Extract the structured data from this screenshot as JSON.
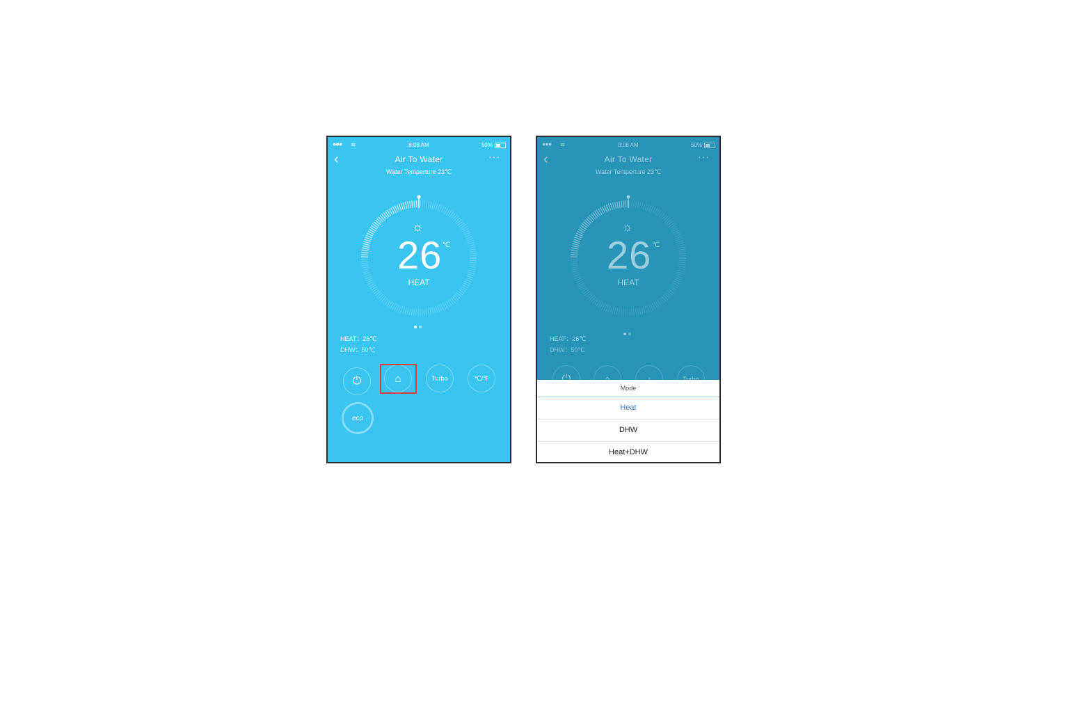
{
  "screens": [
    {
      "status": {
        "signal": "●●●",
        "wifi_icon": "wifi-icon",
        "time": "8:08 AM",
        "battery": "50%",
        "battery_level": 0.5
      },
      "header": {
        "back_glyph": "‹",
        "title": "Air To Water",
        "subtitle": "Water Temperture 23℃",
        "more_glyph": "···"
      },
      "dial": {
        "temperature": "26",
        "unit": "℃",
        "mode": "HEAT",
        "icon": "sun-icon"
      },
      "info": {
        "heat": "HEAT：26℃",
        "dhw": "DHW：50℃"
      },
      "controls": {
        "power_glyph": "⏻",
        "mode_glyph": "⌂",
        "turbo": "Turbo",
        "unit_toggle": "℃/℉",
        "eco": "eco"
      }
    },
    {
      "status": {
        "signal": "●●●",
        "wifi_icon": "wifi-icon",
        "time": "8:08 AM",
        "battery": "50%",
        "battery_level": 0.5
      },
      "header": {
        "back_glyph": "‹",
        "title": "Air To Water",
        "subtitle": "Water Temperture 23℃",
        "more_glyph": "···"
      },
      "dial": {
        "temperature": "26",
        "unit": "℃",
        "mode": "HEAT",
        "icon": "sun-icon"
      },
      "info": {
        "heat": "HEAT：26℃",
        "dhw": "DHW：50℃"
      },
      "controls": {
        "power_glyph": "⏻",
        "mode_glyph": "⌂",
        "turbo": "Turbo"
      },
      "mode_sheet": {
        "title": "Mode",
        "options": [
          "Heat",
          "DHW",
          "Heat+DHW"
        ],
        "selected": "Heat"
      }
    }
  ],
  "colors": {
    "screen_bg": "#39c5ef",
    "dimmed_bg": "#2794b8",
    "highlight": "#e23b3b",
    "selected_option": "#3b79c2"
  }
}
